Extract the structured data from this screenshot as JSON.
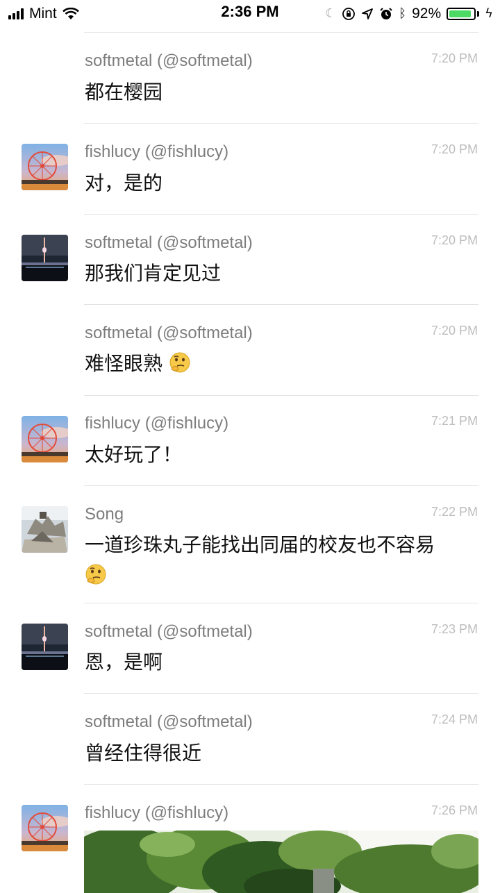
{
  "status_bar": {
    "carrier": "Mint",
    "time": "2:36 PM",
    "battery_percent": "92%",
    "battery_level": 0.92
  },
  "messages": [
    {
      "author": "softmetal (@softmetal)",
      "time": "7:20 PM",
      "text": "都在樱园"
    },
    {
      "author": "fishlucy (@fishlucy)",
      "time": "7:20 PM",
      "text": "对，是的",
      "avatar": "ferris-wheel"
    },
    {
      "author": "softmetal (@softmetal)",
      "time": "7:20 PM",
      "text": "那我们肯定见过",
      "avatar": "night-tower"
    },
    {
      "author": "softmetal (@softmetal)",
      "time": "7:20 PM",
      "text": "难怪眼熟",
      "emoji": "thinking-face-icon"
    },
    {
      "author": "fishlucy (@fishlucy)",
      "time": "7:21 PM",
      "text": "太好玩了！",
      "avatar": "ferris-wheel"
    },
    {
      "author": "Song",
      "time": "7:22 PM",
      "text": "一道珍珠丸子能找出同届的校友也不容易",
      "emoji": "thinking-face-icon",
      "avatar": "sand-sculpture"
    },
    {
      "author": "softmetal (@softmetal)",
      "time": "7:23 PM",
      "text": "恩，是啊",
      "avatar": "night-tower"
    },
    {
      "author": "softmetal (@softmetal)",
      "time": "7:24 PM",
      "text": "曾经住得很近"
    },
    {
      "author": "fishlucy (@fishlucy)",
      "time": "7:26 PM",
      "text": "",
      "avatar": "ferris-wheel",
      "attachment": "photo-of-trees"
    }
  ]
}
